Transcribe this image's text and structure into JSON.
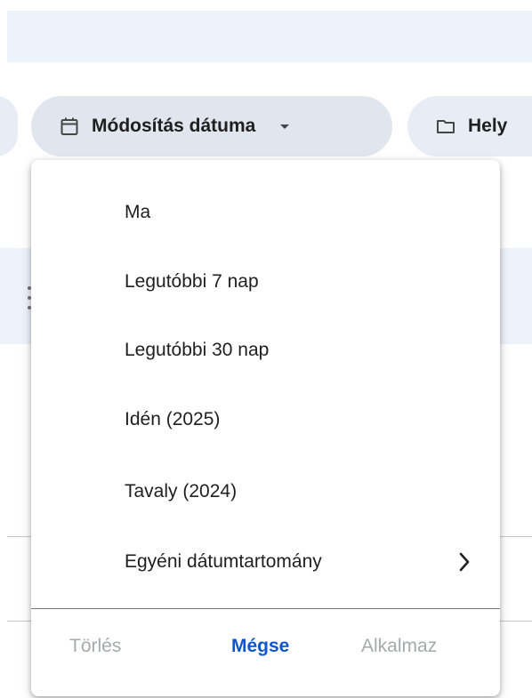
{
  "filters": {
    "date_chip": {
      "label": "Módosítás dátuma",
      "icon": "calendar-icon",
      "caret": "dropdown-caret-icon"
    },
    "location_chip": {
      "label": "Hely",
      "icon": "folder-icon"
    }
  },
  "date_menu": {
    "items": [
      {
        "label": "Ma"
      },
      {
        "label": "Legutóbbi 7 nap"
      },
      {
        "label": "Legutóbbi 30 nap"
      },
      {
        "label": "Idén (2025)"
      },
      {
        "label": "Tavaly (2024)"
      },
      {
        "label": "Egyéni dátumtartomány",
        "icon": "chevron-right-icon"
      }
    ],
    "footer": {
      "clear_label": "Törlés",
      "cancel_label": "Mégse",
      "apply_label": "Alkalmaz"
    }
  },
  "colors": {
    "accent": "#0b57d0",
    "chip_bg": "#e1e5ee",
    "disabled_text": "#a7a9ad",
    "search_bg": "#eef2fb"
  }
}
